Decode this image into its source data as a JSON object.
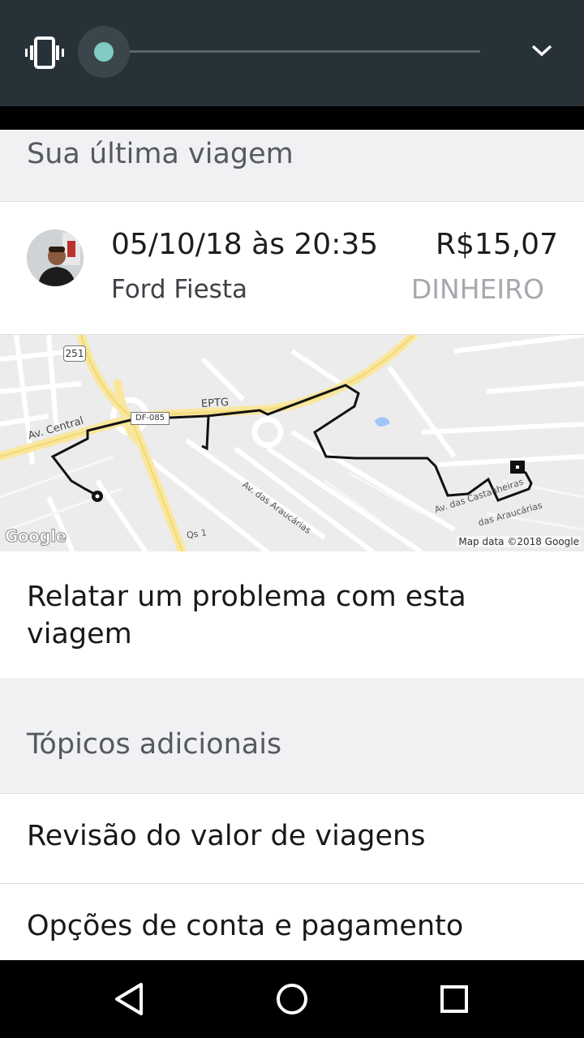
{
  "volume_panel": {
    "icon": "vibrate-icon",
    "level": 0.0,
    "expand_icon": "chevron-down-icon",
    "colors": {
      "background": "#263238",
      "thumb": "#80cbc4"
    }
  },
  "last_trip": {
    "section_title": "Sua última viagem",
    "date_time": "05/10/18 às 20:35",
    "price": "R$15,07",
    "vehicle": "Ford Fiesta",
    "payment_method": "DINHEIRO",
    "driver_avatar": "driver-avatar"
  },
  "map": {
    "road_labels": [
      "251",
      "DF-085",
      "EPTG",
      "Av. Central",
      "Av. das Araucárias",
      "Av. das Castanheiras",
      "das Araucárias",
      "Qs 1"
    ],
    "attribution": "Map data ©2018 Google",
    "logo": "Google",
    "colors": {
      "highway": "#f9e79f",
      "route": "#111111",
      "water": "#9fc5f8"
    }
  },
  "report_problem": {
    "label": "Relatar um problema com esta viagem"
  },
  "additional_topics": {
    "section_title": "Tópicos adicionais",
    "items": [
      {
        "label": "Revisão do valor de viagens"
      },
      {
        "label": "Opções de conta e pagamento"
      }
    ]
  },
  "nav_bar": {
    "buttons": [
      "back-icon",
      "home-icon",
      "recents-icon"
    ]
  }
}
